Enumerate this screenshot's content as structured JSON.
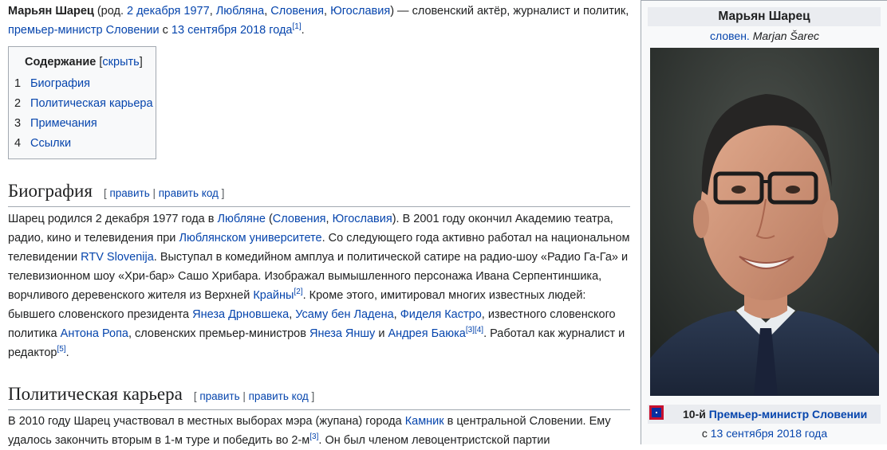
{
  "intro": {
    "name": "Марьян Шарец",
    "born_prefix": " (род. ",
    "born_date": "2 декабря 1977",
    "comma1": ", ",
    "born_city": "Любляна",
    "comma2": ", ",
    "born_country": "Словения",
    "comma3": ", ",
    "born_state": "Югославия",
    "desc": ") — словенский актёр, журналист и политик, ",
    "pm_link": "премьер-министр Словении",
    "since_text": " с ",
    "since_date": "13 сентября 2018 года",
    "ref": "[1]",
    "end": "."
  },
  "toc": {
    "title": "Содержание",
    "hide_open": " [",
    "hide": "скрыть",
    "hide_close": "]",
    "items": [
      {
        "num": "1",
        "label": "Биография"
      },
      {
        "num": "2",
        "label": "Политическая карьера"
      },
      {
        "num": "3",
        "label": "Примечания"
      },
      {
        "num": "4",
        "label": "Ссылки"
      }
    ]
  },
  "sections": {
    "edit_open": "[ ",
    "edit": "править",
    "sep": " | ",
    "edit_code": "править код",
    "edit_close": " ]",
    "bio_title": "Биография",
    "pol_title": "Политическая карьера"
  },
  "bio": {
    "t1": "Шарец родился 2 декабря 1977 года в ",
    "l_ljubljana": "Любляне",
    "t2": " (",
    "l_slovenia": "Словения",
    "t3": ", ",
    "l_yugo": "Югославия",
    "t4": "). В 2001 году окончил Академию театра, радио, кино и телевидения при ",
    "l_uni": "Люблянском университете",
    "t5": ". Со следующего года активно работал на национальном телевидении ",
    "l_rtv": "RTV Slovenija",
    "t6": ". Выступал в комедийном амплуа и политической сатире на радио-шоу «Радио Га-Га» и телевизионном шоу «Хри-бар» Сашо Хрибара. Изображал вымышленного персонажа Ивана Серпентиншика, ворчливого деревенского жителя из Верхней ",
    "l_krajny": "Крайны",
    "r2": "[2]",
    "t7": ". Кроме этого, имитировал многих известных людей: бывшего словенского президента ",
    "l_drnovsek": "Янеза Дрновшека",
    "t8": ", ",
    "l_laden": "Усаму бен Ладена",
    "t9": ", ",
    "l_castro": "Фиделя Кастро",
    "t10": ", известного словенского политика ",
    "l_rop": "Антона Ропа",
    "t11": ", словенских премьер-министров ",
    "l_jansa": "Янеза Яншу",
    "t12": " и ",
    "l_bajuk": "Андрея Баюка",
    "r3": "[3]",
    "r4": "[4]",
    "t13": ". Работал как журналист и редактор",
    "r5": "[5]",
    "t14": "."
  },
  "pol": {
    "t1": "В 2010 году Шарец участвовал в местных выборах мэра (жупана) города ",
    "l_kamnik": "Камник",
    "t2": " в центральной Словении. Ему удалось закончить вторым в 1-м туре и победить во 2-м",
    "r3": "[3]",
    "t3": ". Он был членом левоцентристской партии"
  },
  "infobox": {
    "name": "Марьян Шарец",
    "native_link": "словен.",
    "native_name": "Marjan Šarec",
    "office_ordinal": "10-й ",
    "office_link": "Премьер-министр Словении",
    "since_text": "с ",
    "since_link": "13 сентября 2018 года",
    "colors": {
      "flag_red": "#c8102e",
      "flag_blue": "#0a2fa0"
    }
  }
}
